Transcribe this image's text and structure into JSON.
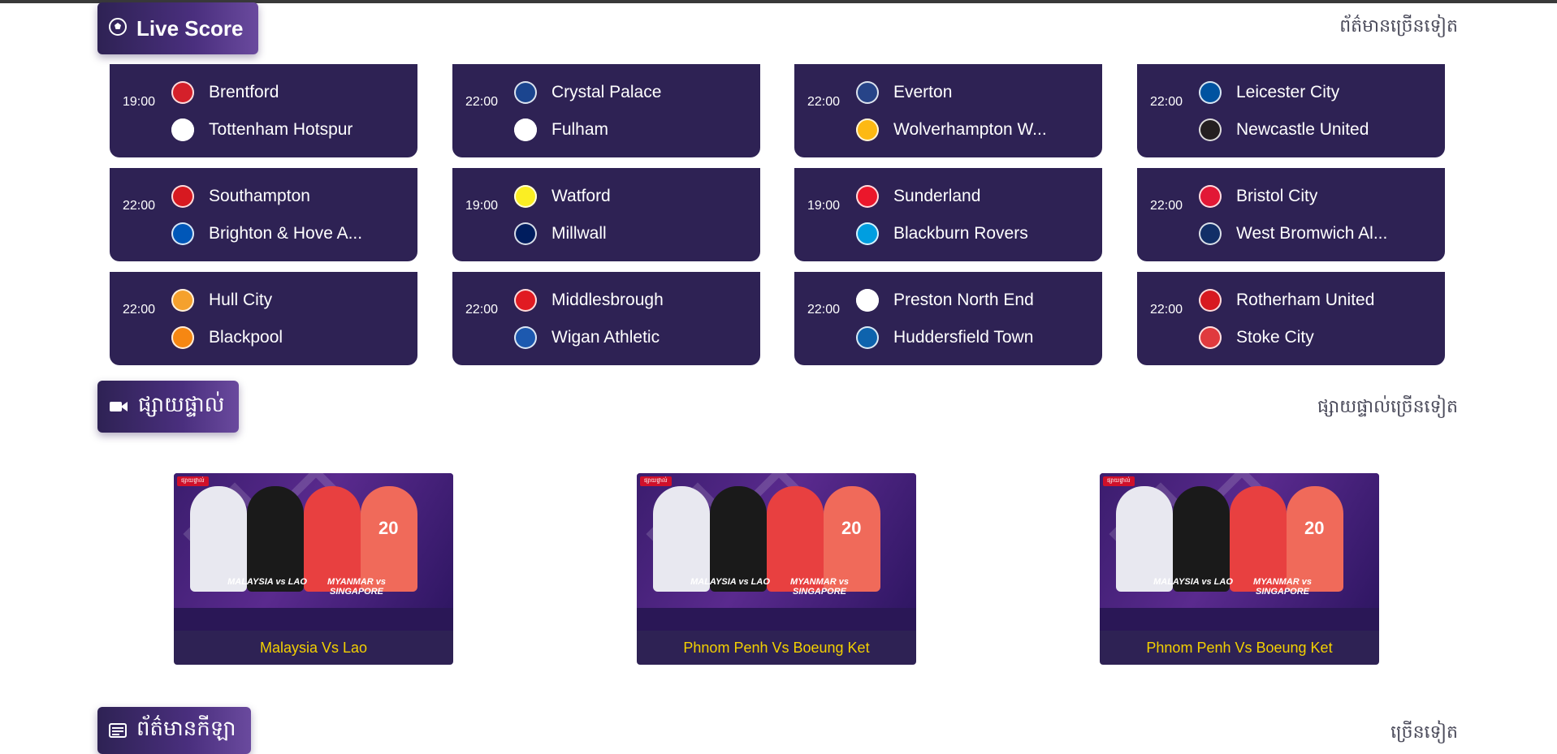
{
  "sections": {
    "livescore": {
      "title": "Live Score",
      "icon": "soccer-ball-icon",
      "more": "ព័ត៌មានច្រើនទៀត"
    },
    "livestream": {
      "title": "ផ្សាយផ្ទាល់",
      "icon": "video-camera-icon",
      "more": "ផ្សាយផ្ទាល់ច្រើនទៀត"
    },
    "news": {
      "title": "ព័ត៌មានកីឡា",
      "icon": "newspaper-icon",
      "more": "ច្រើនទៀត"
    }
  },
  "matches": [
    {
      "time": "19:00",
      "home": "Brentford",
      "away": "Tottenham Hotspur",
      "home_color": "#d4202a",
      "away_color": "#ffffff"
    },
    {
      "time": "22:00",
      "home": "Crystal Palace",
      "away": "Fulham",
      "home_color": "#1b458f",
      "away_color": "#ffffff"
    },
    {
      "time": "22:00",
      "home": "Everton",
      "away": "Wolverhampton W...",
      "home_color": "#274488",
      "away_color": "#fdb913"
    },
    {
      "time": "22:00",
      "home": "Leicester City",
      "away": "Newcastle United",
      "home_color": "#0053a0",
      "away_color": "#241f20"
    },
    {
      "time": "22:00",
      "home": "Southampton",
      "away": "Brighton & Hove A...",
      "home_color": "#d71920",
      "away_color": "#0057b8"
    },
    {
      "time": "19:00",
      "home": "Watford",
      "away": "Millwall",
      "home_color": "#fbee23",
      "away_color": "#001d5e"
    },
    {
      "time": "19:00",
      "home": "Sunderland",
      "away": "Blackburn Rovers",
      "home_color": "#eb172b",
      "away_color": "#009ee0"
    },
    {
      "time": "22:00",
      "home": "Bristol City",
      "away": "West Bromwich Al...",
      "home_color": "#e21836",
      "away_color": "#122f67"
    },
    {
      "time": "22:00",
      "home": "Hull City",
      "away": "Blackpool",
      "home_color": "#f5a12d",
      "away_color": "#f68712"
    },
    {
      "time": "22:00",
      "home": "Middlesbrough",
      "away": "Wigan Athletic",
      "home_color": "#e11b22",
      "away_color": "#1d59af"
    },
    {
      "time": "22:00",
      "home": "Preston North End",
      "away": "Huddersfield Town",
      "home_color": "#ffffff",
      "away_color": "#0e63ad"
    },
    {
      "time": "22:00",
      "home": "Rotherham United",
      "away": "Stoke City",
      "home_color": "#d71920",
      "away_color": "#e03a3e"
    }
  ],
  "live_streams": [
    {
      "title": "Malaysia Vs Lao",
      "poster": {
        "tag": "ផ្សាយផ្ទាល់",
        "match1": "MALAYSIA vs LAO",
        "match2": "MYANMAR vs SINGAPORE",
        "number": "20"
      }
    },
    {
      "title": "Phnom Penh Vs Boeung Ket",
      "poster": {
        "tag": "ផ្សាយផ្ទាល់",
        "match1": "MALAYSIA vs LAO",
        "match2": "MYANMAR vs SINGAPORE",
        "number": "20"
      }
    },
    {
      "title": "Phnom Penh Vs Boeung Ket",
      "poster": {
        "tag": "ផ្សាយផ្ទាល់",
        "match1": "MALAYSIA vs LAO",
        "match2": "MYANMAR vs SINGAPORE",
        "number": "20"
      }
    }
  ],
  "colors": {
    "card_bg": "#2e2254",
    "accent_yellow": "#f3d000",
    "badge_start": "#2e2254",
    "badge_end": "#6a4a9e"
  }
}
